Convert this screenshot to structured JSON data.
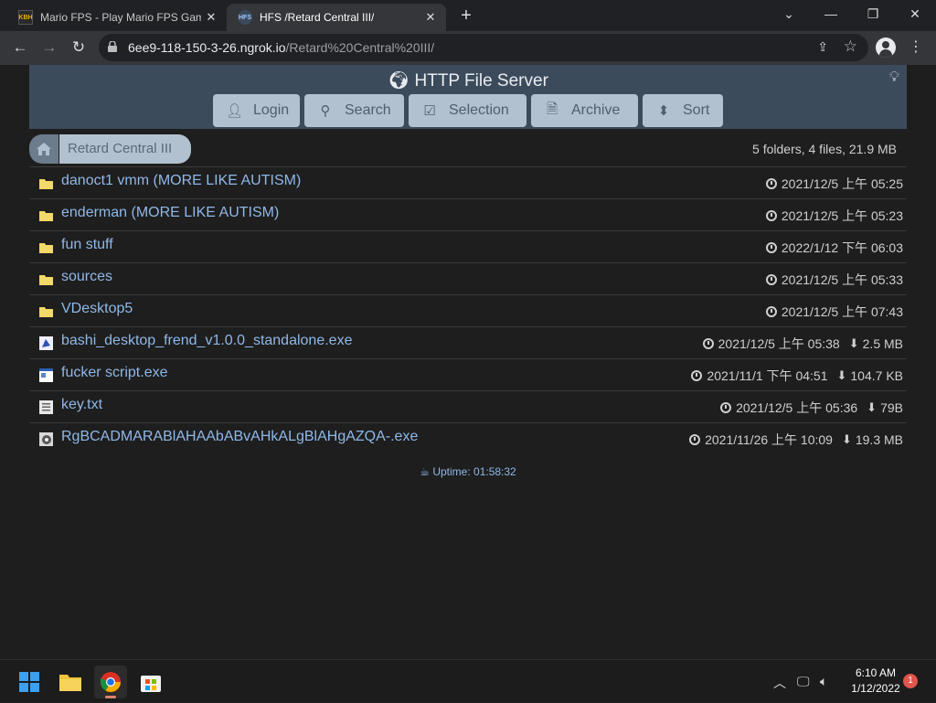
{
  "browser": {
    "tabs": [
      {
        "favicon": "KBH",
        "title": "Mario FPS - Play Mario FPS Game"
      },
      {
        "favicon": "HFS",
        "title": "HFS /Retard Central III/"
      }
    ],
    "url_host": "6ee9-118-150-3-26.ngrok.io",
    "url_path": "/Retard%20Central%20III/"
  },
  "hfs": {
    "title": "HTTP File Server",
    "buttons": {
      "login": "Login",
      "search": "Search",
      "selection": "Selection",
      "archive": "Archive",
      "sort": "Sort"
    },
    "breadcrumb": "Retard Central III",
    "summary": "5 folders, 4 files, 21.9 MB",
    "items": [
      {
        "name": "danoct1 vmm (MORE LIKE AUTISM)",
        "date": "2021/12/5 上午 05:25",
        "size": "",
        "icon": "folder-icon"
      },
      {
        "name": "enderman (MORE LIKE AUTISM)",
        "date": "2021/12/5 上午 05:23",
        "size": "",
        "icon": "folder-icon"
      },
      {
        "name": "fun stuff",
        "date": "2022/1/12 下午 06:03",
        "size": "",
        "icon": "folder-icon"
      },
      {
        "name": "sources",
        "date": "2021/12/5 上午 05:33",
        "size": "",
        "icon": "folder-icon"
      },
      {
        "name": "VDesktop5",
        "date": "2021/12/5 上午 07:43",
        "size": "",
        "icon": "folder-icon"
      },
      {
        "name": "bashi_desktop_frend_v1.0.0_standalone.exe",
        "date": "2021/12/5 上午 05:38",
        "size": "2.5 MB",
        "icon": "exe-icon"
      },
      {
        "name": "fucker script.exe",
        "date": "2021/11/1 下午 04:51",
        "size": "104.7 KB",
        "icon": "exe-icon"
      },
      {
        "name": "key.txt",
        "date": "2021/12/5 上午 05:36",
        "size": "79B",
        "icon": "text-file-icon"
      },
      {
        "name": "RgBCADMARABlAHAAbABvAHkALgBlAHgAZQA-.exe",
        "date": "2021/11/26 上午 10:09",
        "size": "19.3 MB",
        "icon": "exe-icon"
      }
    ],
    "uptime": "Uptime: 01:58:32"
  },
  "taskbar": {
    "time": "6:10 AM",
    "date": "1/12/2022",
    "notifications": "1"
  }
}
